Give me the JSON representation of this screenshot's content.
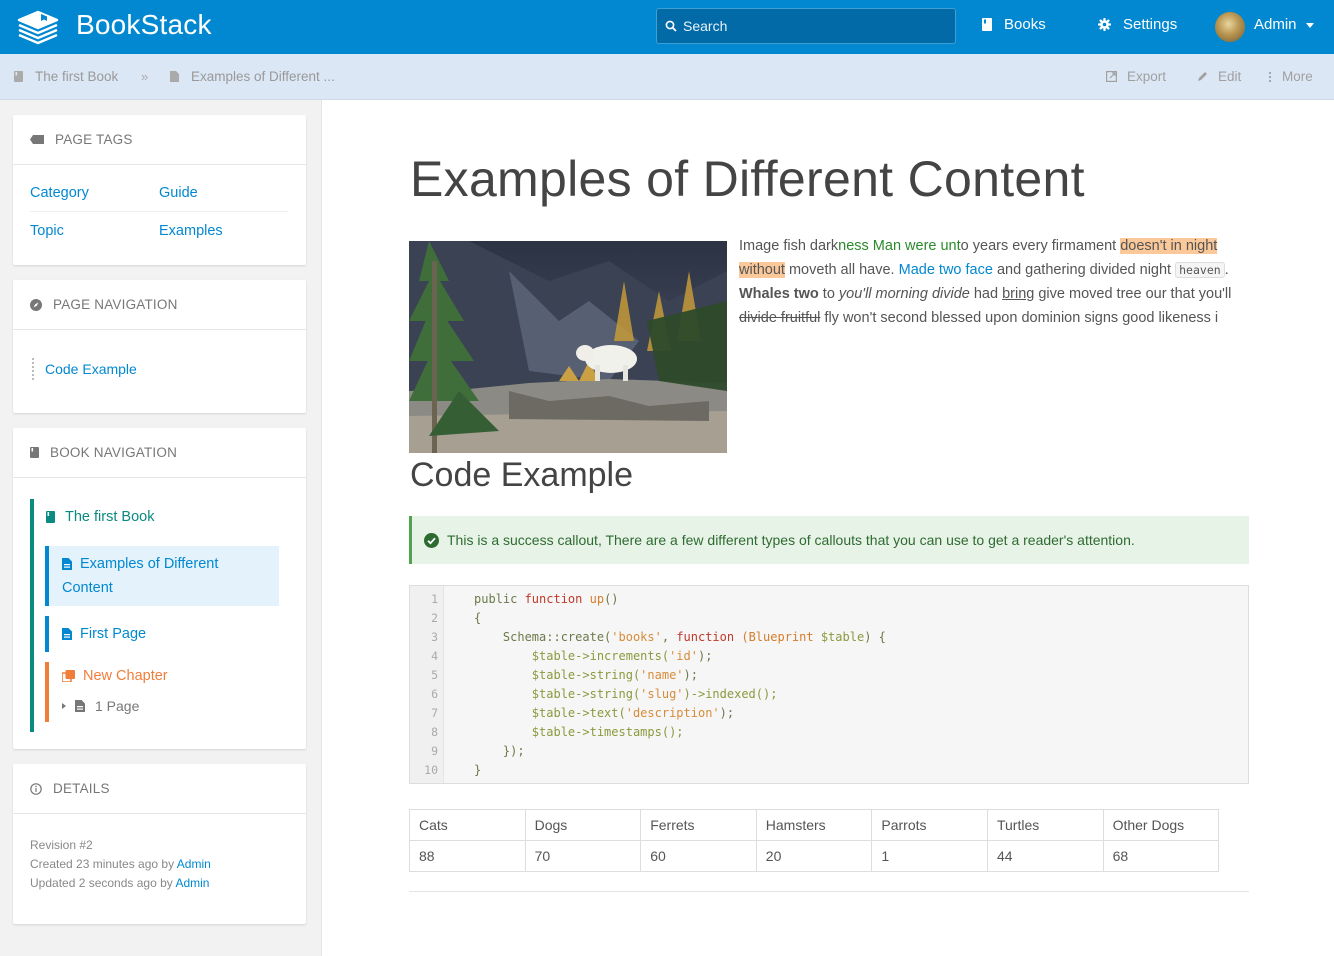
{
  "header": {
    "app_name": "BookStack",
    "search_placeholder": "Search",
    "nav": [
      {
        "label": "Books",
        "icon": "book-icon"
      },
      {
        "label": "Settings",
        "icon": "gear-icon"
      }
    ],
    "user": {
      "name": "Admin"
    }
  },
  "breadcrumb": {
    "items": [
      {
        "label": "The first Book",
        "icon": "book-icon"
      },
      {
        "label": "Examples of Different ...",
        "icon": "page-icon"
      }
    ],
    "separator": "»"
  },
  "actions": [
    {
      "label": "Export",
      "icon": "export-icon"
    },
    {
      "label": "Edit",
      "icon": "pencil-icon"
    },
    {
      "label": "More",
      "icon": "more-vertical-icon"
    }
  ],
  "sidebar": {
    "tags": {
      "title": "PAGE TAGS",
      "items": [
        {
          "name": "Category",
          "value": "Guide"
        },
        {
          "name": "Topic",
          "value": "Examples"
        }
      ]
    },
    "page_nav": {
      "title": "PAGE NAVIGATION",
      "items": [
        {
          "label": "Code Example"
        }
      ]
    },
    "book_nav": {
      "title": "BOOK NAVIGATION",
      "book": "The first Book",
      "current_page": "Examples of Different Content",
      "pages": [
        "First Page"
      ],
      "chapter": {
        "title": "New Chapter",
        "count_label": "1 Page"
      }
    },
    "details": {
      "title": "DETAILS",
      "revision": "Revision #2",
      "created_prefix": "Created 23 minutes ago by ",
      "created_by": "Admin",
      "updated_prefix": "Updated 2 seconds ago by ",
      "updated_by": "Admin"
    }
  },
  "page": {
    "title": "Examples of Different Content",
    "paragraph": {
      "p1": "Image fish dark",
      "p2_green": "ness Man were unt",
      "p3": "o years every firmament ",
      "p4_highlight_a": "doesn't in night",
      "p4_highlight_b": "without",
      "p5": " moveth all have. ",
      "p6_link": "Made two face",
      "p7": " and gathering divided night ",
      "p8_code": "heaven",
      "p9": ". ",
      "p10_bold": "Whales two",
      "p11": " to ",
      "p12_italic": "you'll morning divide",
      "p13": " had ",
      "p14_underline": "bring",
      "p15": " give moved tree our that you'll ",
      "p16_strike": "divide fruitful",
      "p17": " fly won't second blessed upon dominion signs good likeness i"
    },
    "section_heading": "Code Example",
    "callout": "This is a success callout, There are a few different types of callouts that you can use to get a reader's attention.",
    "code": {
      "lines": [
        [
          {
            "t": "public ",
            "c": "plain"
          },
          {
            "t": "function ",
            "c": "kw"
          },
          {
            "t": "up",
            "c": "fn"
          },
          {
            "t": "()",
            "c": "plain"
          }
        ],
        [
          {
            "t": "{",
            "c": "plain"
          }
        ],
        [
          {
            "t": "    Schema::create(",
            "c": "plain"
          },
          {
            "t": "'books'",
            "c": "str"
          },
          {
            "t": ", ",
            "c": "plain"
          },
          {
            "t": "function ",
            "c": "kw"
          },
          {
            "t": "(Blueprint ",
            "c": "fn"
          },
          {
            "t": "$table",
            "c": "var"
          },
          {
            "t": ") {",
            "c": "plain"
          }
        ],
        [
          {
            "t": "        $table->increments(",
            "c": "var"
          },
          {
            "t": "'id'",
            "c": "str"
          },
          {
            "t": ");",
            "c": "plain"
          }
        ],
        [
          {
            "t": "        $table->string(",
            "c": "var"
          },
          {
            "t": "'name'",
            "c": "str"
          },
          {
            "t": ");",
            "c": "plain"
          }
        ],
        [
          {
            "t": "        $table->string(",
            "c": "var"
          },
          {
            "t": "'slug'",
            "c": "str"
          },
          {
            "t": ")->indexed();",
            "c": "var"
          }
        ],
        [
          {
            "t": "        $table->text(",
            "c": "var"
          },
          {
            "t": "'description'",
            "c": "str"
          },
          {
            "t": ");",
            "c": "plain"
          }
        ],
        [
          {
            "t": "        $table->timestamps();",
            "c": "var"
          }
        ],
        [
          {
            "t": "    });",
            "c": "plain"
          }
        ],
        [
          {
            "t": "}",
            "c": "plain"
          }
        ]
      ]
    },
    "table": {
      "headers": [
        "Cats",
        "Dogs",
        "Ferrets",
        "Hamsters",
        "Parrots",
        "Turtles",
        "Other Dogs"
      ],
      "rows": [
        [
          "88",
          "70",
          "60",
          "20",
          "1",
          "44",
          "68"
        ]
      ]
    }
  }
}
